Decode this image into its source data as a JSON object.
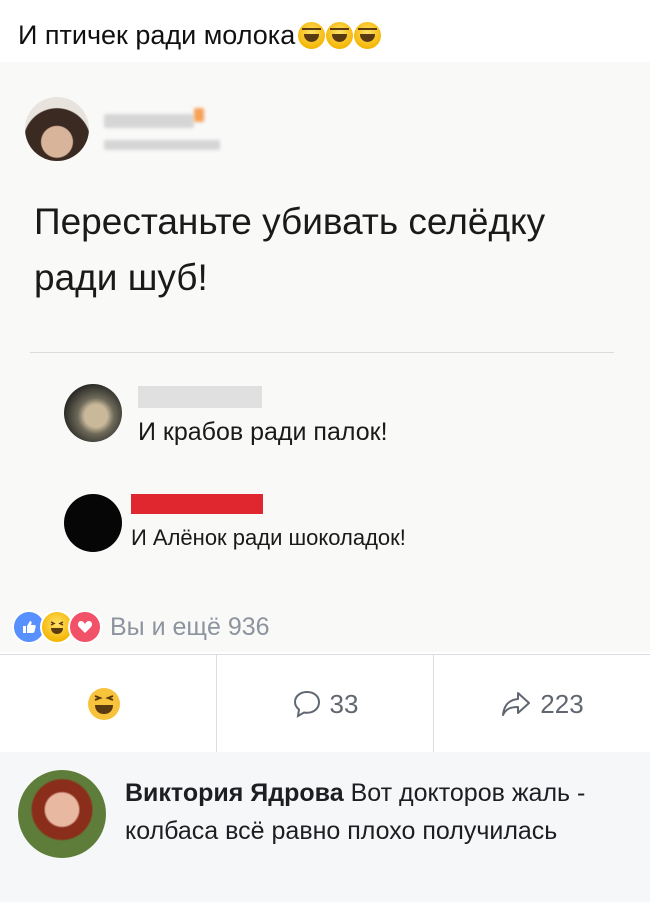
{
  "caption": {
    "text": "И птичек ради молока",
    "emojis": [
      "laughing-emoji",
      "laughing-emoji",
      "laughing-emoji"
    ]
  },
  "post": {
    "text": "Перестаньте убивать селёдку ради шуб!",
    "comments": [
      {
        "text": "И крабов ради палок!"
      },
      {
        "text": "И Алёнок ради шоколадок!"
      }
    ]
  },
  "reactions": {
    "icons": [
      "like-icon",
      "haha-icon",
      "love-icon"
    ],
    "text": "Вы и ещё 936"
  },
  "actions": {
    "comments_count": "33",
    "shares_count": "223"
  },
  "comment": {
    "author": "Виктория Ядрова",
    "text": "Вот докторов жаль - колбаса всё равно плохо получилась"
  },
  "colors": {
    "like": "#5890ff",
    "love": "#f25268",
    "haha": "#f4b400",
    "name_bar_red": "#e0262e"
  }
}
